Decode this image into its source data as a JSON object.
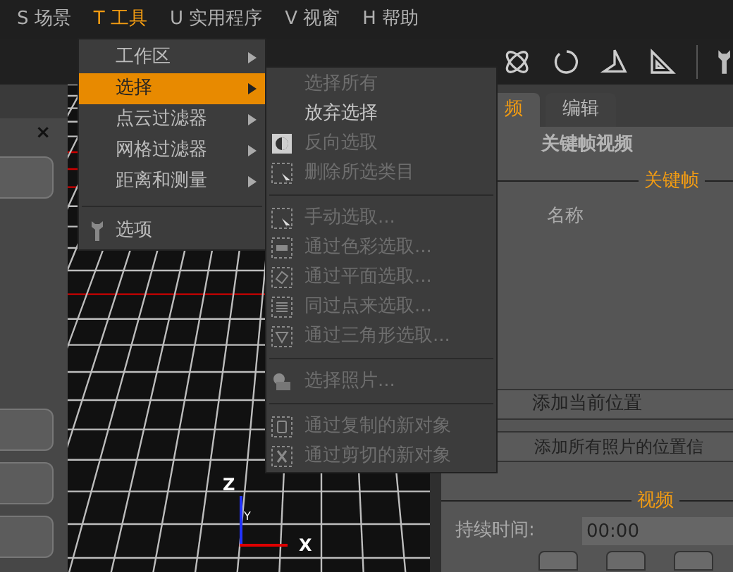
{
  "menu_bar": [
    {
      "label": "S 场景",
      "selected": false
    },
    {
      "label": "T 工具",
      "selected": true
    },
    {
      "label": "U 实用程序",
      "selected": false
    },
    {
      "label": "V 视窗",
      "selected": false
    },
    {
      "label": "H 帮助",
      "selected": false
    }
  ],
  "tools_menu": [
    {
      "kind": "submenu",
      "label": "工作区",
      "selected": false
    },
    {
      "kind": "submenu",
      "label": "选择",
      "selected": true
    },
    {
      "kind": "submenu",
      "label": "点云过滤器",
      "selected": false
    },
    {
      "kind": "submenu",
      "label": "网格过滤器",
      "selected": false
    },
    {
      "kind": "submenu",
      "label": "距离和测量",
      "selected": false
    },
    {
      "kind": "separator"
    },
    {
      "kind": "item",
      "label": "选项",
      "selected": false
    }
  ],
  "select_submenu": [
    {
      "kind": "item",
      "label": "选择所有",
      "disabled": true
    },
    {
      "kind": "item",
      "label": "放弃选择",
      "disabled": false
    },
    {
      "kind": "item",
      "label": "反向选取",
      "disabled": true
    },
    {
      "kind": "item",
      "label": "删除所选类目",
      "disabled": true
    },
    {
      "kind": "separator"
    },
    {
      "kind": "item",
      "label": "手动选取...",
      "disabled": true
    },
    {
      "kind": "item",
      "label": "通过色彩选取...",
      "disabled": true
    },
    {
      "kind": "item",
      "label": "通过平面选取...",
      "disabled": true
    },
    {
      "kind": "item",
      "label": "同过点来选取...",
      "disabled": true
    },
    {
      "kind": "item",
      "label": "通过三角形选取...",
      "disabled": true
    },
    {
      "kind": "separator"
    },
    {
      "kind": "item",
      "label": "选择照片...",
      "disabled": true
    },
    {
      "kind": "separator"
    },
    {
      "kind": "item",
      "label": "通过复制的新对象",
      "disabled": true
    },
    {
      "kind": "item",
      "label": "通过剪切的新对象",
      "disabled": true
    }
  ],
  "left_panel": {
    "close": "×"
  },
  "viewport": {
    "axes": {
      "z": "Z",
      "y": "Y",
      "x": "X"
    }
  },
  "right_panel": {
    "tabs": [
      {
        "label": "频",
        "selected": true
      },
      {
        "label": "编辑",
        "selected": false
      }
    ],
    "title": "关键帧视频",
    "keyframes": {
      "title": "关键帧",
      "column": "名称"
    },
    "buttons": [
      "添加当前位置",
      "添加所有照片的位置信"
    ],
    "video": {
      "title": "视频",
      "duration_label": "持续时间:",
      "duration_value": "00:00"
    }
  }
}
